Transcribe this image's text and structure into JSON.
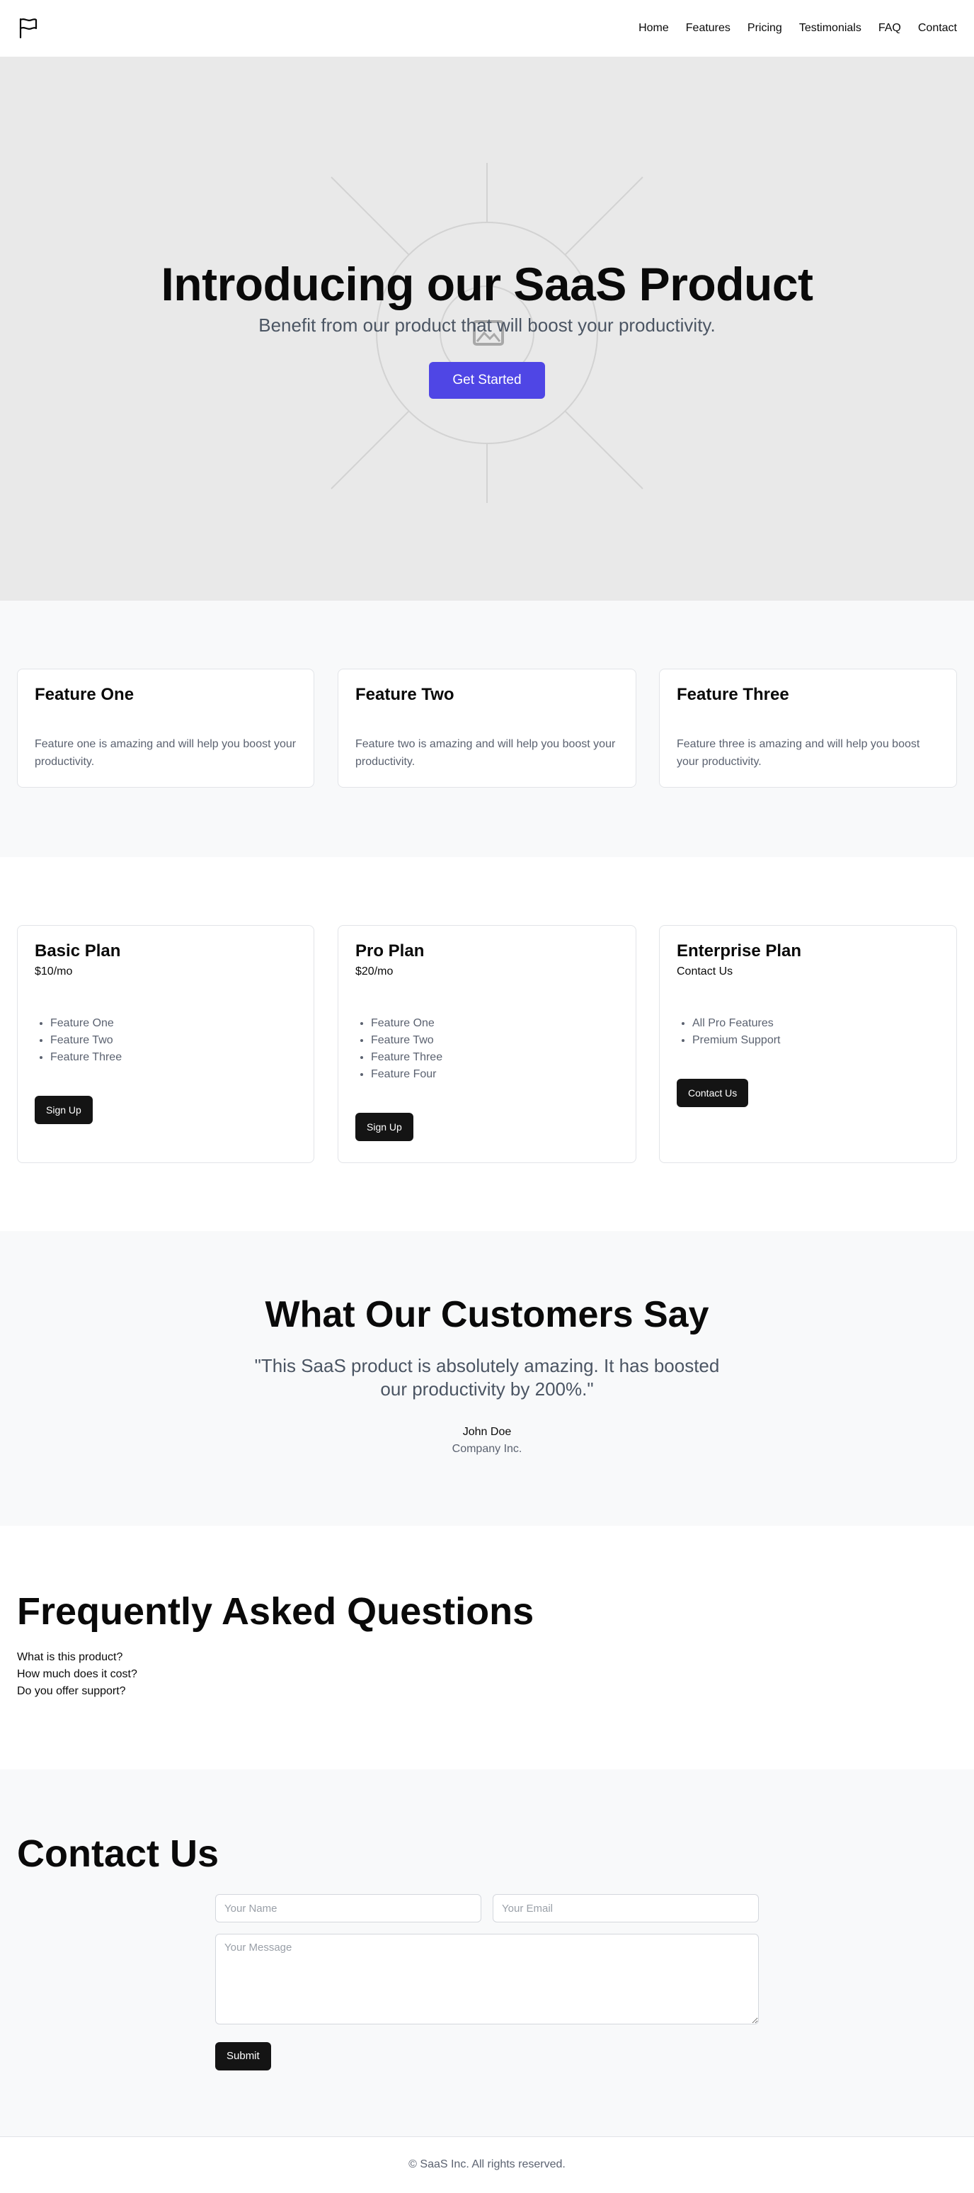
{
  "colors": {
    "accent": "#4f46e5",
    "hero_bg": "#e9e9e9",
    "section_alt_bg": "#f8f9fa",
    "dark_button": "#141414",
    "muted_text": "#5b6270"
  },
  "header": {
    "logo_icon": "flag-icon",
    "nav": [
      "Home",
      "Features",
      "Pricing",
      "Testimonials",
      "FAQ",
      "Contact"
    ]
  },
  "hero": {
    "title": "Introducing our SaaS Product",
    "subtitle": "Benefit from our product that will boost your productivity.",
    "cta": "Get Started",
    "image_icon": "image-placeholder-icon"
  },
  "features": [
    {
      "title": "Feature One",
      "text": "Feature one is amazing and will help you boost your productivity."
    },
    {
      "title": "Feature Two",
      "text": "Feature two is amazing and will help you boost your productivity."
    },
    {
      "title": "Feature Three",
      "text": "Feature three is amazing and will help you boost your productivity."
    }
  ],
  "pricing": [
    {
      "name": "Basic Plan",
      "price": "$10/mo",
      "items": [
        "Feature One",
        "Feature Two",
        "Feature Three"
      ],
      "button": "Sign Up"
    },
    {
      "name": "Pro Plan",
      "price": "$20/mo",
      "items": [
        "Feature One",
        "Feature Two",
        "Feature Three",
        "Feature Four"
      ],
      "button": "Sign Up"
    },
    {
      "name": "Enterprise Plan",
      "price": "Contact Us",
      "items": [
        "All Pro Features",
        "Premium Support"
      ],
      "button": "Contact Us"
    }
  ],
  "testimonials": {
    "title": "What Our Customers Say",
    "quote": "\"This SaaS product is absolutely amazing. It has boosted our productivity by 200%.\"",
    "author": "John Doe",
    "company": "Company Inc."
  },
  "faq": {
    "title": "Frequently Asked Questions",
    "questions": [
      "What is this product?",
      "How much does it cost?",
      "Do you offer support?"
    ]
  },
  "contact": {
    "title": "Contact Us",
    "name_placeholder": "Your Name",
    "email_placeholder": "Your Email",
    "message_placeholder": "Your Message",
    "submit": "Submit"
  },
  "footer": {
    "copyright": "© SaaS Inc. All rights reserved."
  }
}
